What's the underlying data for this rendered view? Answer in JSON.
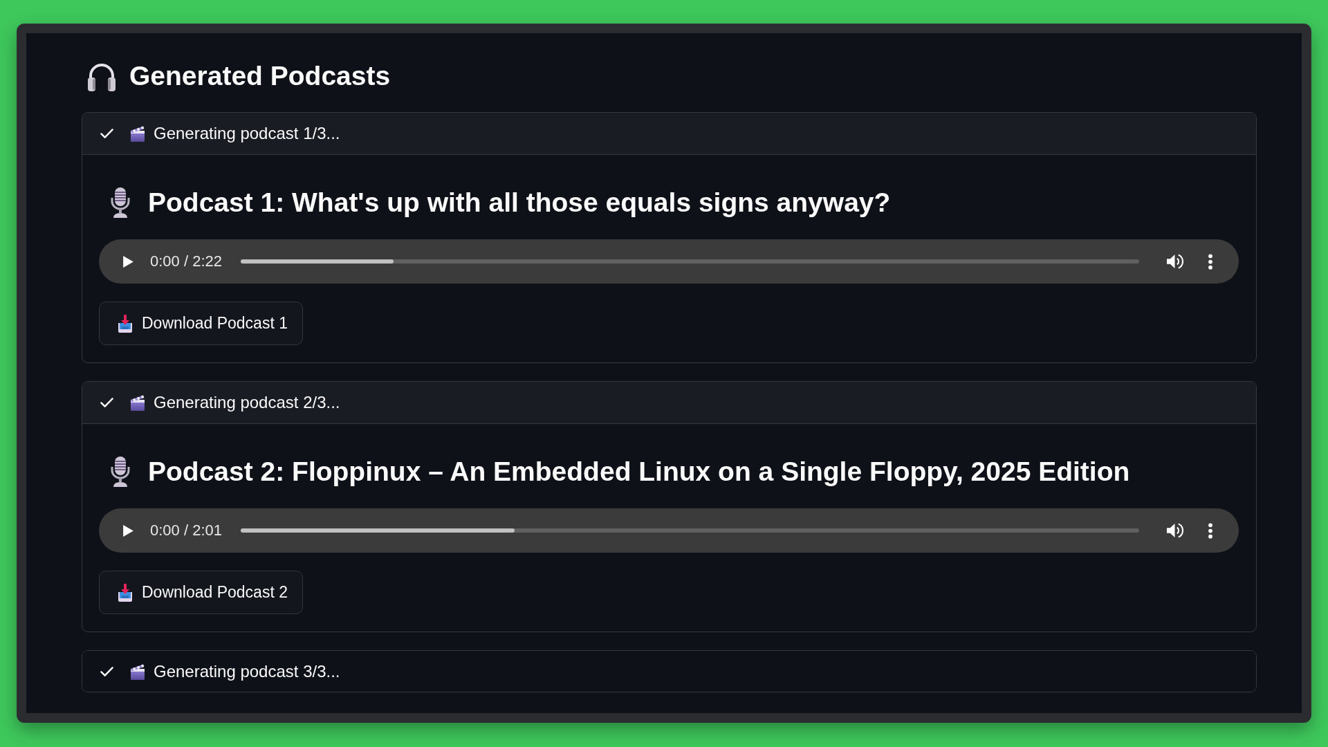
{
  "heading": {
    "title": "Generated Podcasts"
  },
  "statuses": [
    {
      "label": "Generating podcast 1/3...",
      "done": true,
      "expanded": true,
      "podcast": {
        "title": "Podcast 1: What's up with all those equals signs anyway?",
        "player": {
          "time": "0:00 / 2:22",
          "level": 0.17
        },
        "download_button": "Download Podcast 1"
      }
    },
    {
      "label": "Generating podcast 2/3...",
      "done": true,
      "expanded": true,
      "podcast": {
        "title": "Podcast 2: Floppinux – An Embedded Linux on a Single Floppy, 2025 Edition",
        "player": {
          "time": "0:00 / 2:01",
          "level": 0.305
        },
        "download_button": "Download Podcast 2"
      }
    },
    {
      "label": "Generating podcast 3/3...",
      "done": true,
      "expanded": false
    }
  ]
}
